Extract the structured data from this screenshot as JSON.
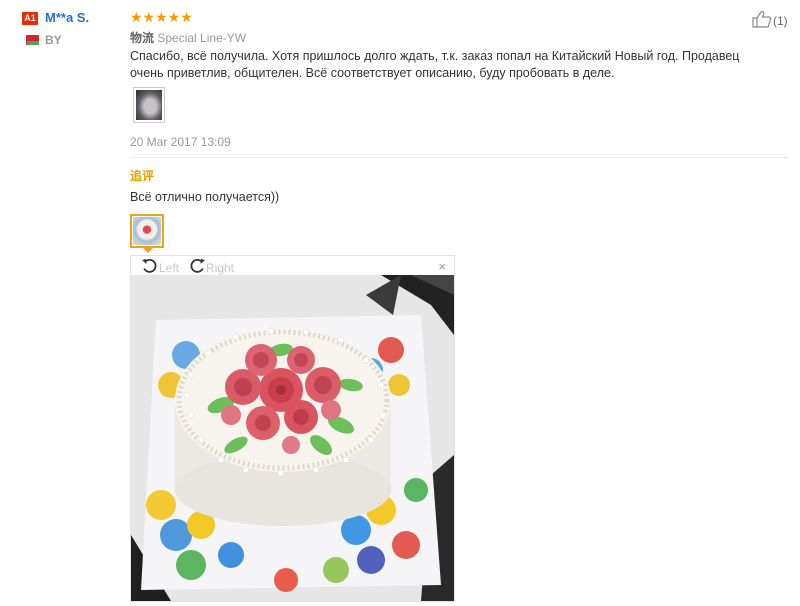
{
  "reviewer": {
    "badge": "A1",
    "name": "M**a S.",
    "country": "BY"
  },
  "review": {
    "stars": "★★★★★",
    "rating": 5,
    "shipping_label": "物流",
    "shipping_method": "Special Line-YW",
    "text": "Спасибо, всё получила. Хотя пришлось долго ждать, т.к. заказ попал на Китайский Новый год. Продавец очень приветлив, общителен. Всё соответствует описанию, буду пробовать в деле.",
    "date": "20 Mar 2017 13:09",
    "helpful_count": "(1)"
  },
  "followup": {
    "label": "追评",
    "text": "Всё отлично получается))"
  },
  "viewer": {
    "rotate_left": "Left",
    "rotate_right": "Right",
    "close": "×"
  },
  "colors": {
    "accent_orange": "#ff9900",
    "name_blue": "#2b6fc2",
    "badge_red": "#e62e04",
    "followup_gold": "#e6a000"
  },
  "icons": [
    "thumbs-up-icon",
    "rotate-left-icon",
    "rotate-right-icon",
    "close-icon",
    "belarus-flag-icon"
  ]
}
